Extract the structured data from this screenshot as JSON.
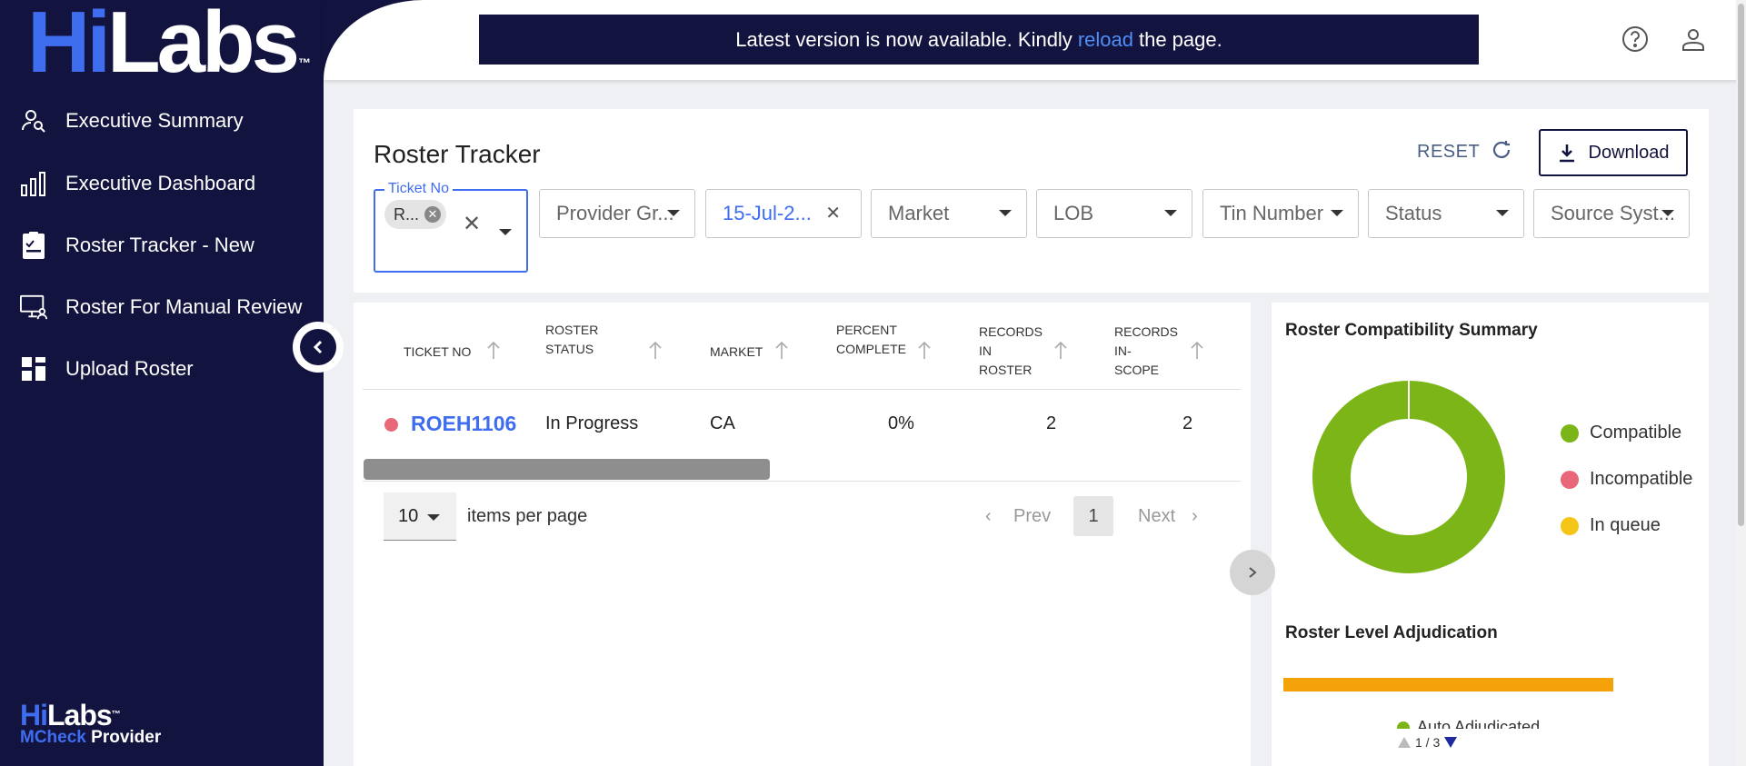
{
  "sidebar": {
    "logo_hi": "Hi",
    "logo_labs": "Labs",
    "logo_tm": "™",
    "items": [
      {
        "label": "Executive Summary",
        "icon": "user-search-icon"
      },
      {
        "label": "Executive Dashboard",
        "icon": "bar-chart-icon"
      },
      {
        "label": "Roster Tracker - New",
        "icon": "checklist-icon"
      },
      {
        "label": "Roster For Manual Review",
        "icon": "monitor-user-icon"
      },
      {
        "label": "Upload Roster",
        "icon": "grid-icon"
      }
    ],
    "brand_hi": "Hi",
    "brand_labs": "Labs",
    "brand_tm": "™",
    "brand_mcheck": "MCheck",
    "brand_provider": "Provider"
  },
  "banner": {
    "text_before": "Latest version is now available. Kindly",
    "link": "reload",
    "text_after": "the page."
  },
  "header": {
    "title": "Roster Tracker",
    "reset": "RESET",
    "download": "Download"
  },
  "filters": {
    "ticket_label": "Ticket No",
    "ticket_chip": "R...",
    "provider_group": "Provider Gr...",
    "date": "15-Jul-2...",
    "market": "Market",
    "lob": "LOB",
    "tin": "Tin Number",
    "status": "Status",
    "source": "Source Syst..."
  },
  "table": {
    "headers": {
      "ticket": "TICKET NO",
      "status_1": "ROSTER",
      "status_2": "STATUS",
      "market": "MARKET",
      "percent_1": "PERCENT",
      "percent_2": "COMPLETE",
      "records_1": "RECORDS",
      "records_2": "IN",
      "records_3": "ROSTER",
      "inscope_1": "RECORDS",
      "inscope_2": "IN-",
      "inscope_3": "SCOPE"
    },
    "rows": [
      {
        "ticket": "ROEH1106",
        "status": "In Progress",
        "market": "CA",
        "percent": "0%",
        "records": "2",
        "inscope": "2",
        "status_color": "#e8687a"
      }
    ],
    "items_per_page": "10",
    "items_per_page_label": "items per page",
    "prev": "Prev",
    "page": "1",
    "next": "Next"
  },
  "summary": {
    "compat_title": "Roster Compatibility Summary",
    "legend": [
      {
        "label": "Compatible",
        "color": "#7cb518"
      },
      {
        "label": "Incompatible",
        "color": "#e8687a"
      },
      {
        "label": "In queue",
        "color": "#f5c518"
      }
    ],
    "adjudication_title": "Roster Level Adjudication",
    "adjudication_legend_partial": "Auto Adjudicated",
    "legend_page": "1 / 3"
  },
  "chart_data": {
    "type": "pie",
    "title": "Roster Compatibility Summary",
    "categories": [
      "Compatible",
      "Incompatible",
      "In queue"
    ],
    "values": [
      100,
      0,
      0
    ],
    "legend": "right"
  }
}
